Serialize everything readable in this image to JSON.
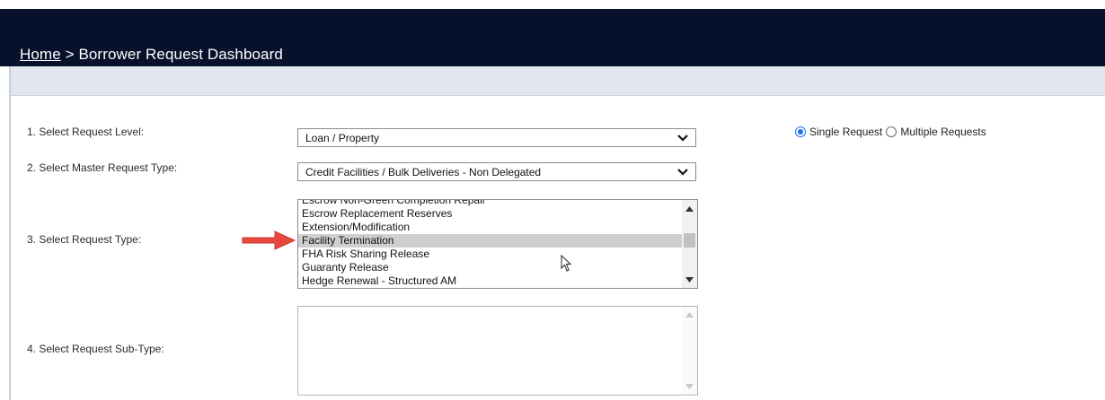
{
  "header": {
    "breadcrumb": {
      "home": "Home",
      "separator": " > ",
      "current": "Borrower Request Dashboard"
    }
  },
  "form": {
    "request_level": {
      "label": "1. Select Request Level:",
      "value": "Loan / Property"
    },
    "master_request_type": {
      "label": "2. Select Master Request Type:",
      "value": "Credit Facilities / Bulk Deliveries - Non Delegated"
    },
    "request_type": {
      "label": "3. Select Request Type:",
      "options": [
        "Escrow Non-Green Completion Repair",
        "Escrow Replacement Reserves",
        "Extension/Modification",
        "Facility Termination",
        "FHA Risk Sharing Release",
        "Guaranty Release",
        "Hedge Renewal - Structured AM"
      ],
      "selected": "Facility Termination"
    },
    "request_sub_type": {
      "label": "4. Select Request Sub-Type:",
      "value": ""
    },
    "mode": {
      "single_label": "Single Request",
      "multiple_label": "Multiple Requests",
      "selected": "Single Request"
    }
  },
  "colors": {
    "header_bg": "#08112b",
    "accent_arrow": "#e8473b",
    "radio_selected": "#1a73e8",
    "selected_row": "#cfcfcf"
  },
  "icons": [
    "chevron-down-icon",
    "scroll-up-icon",
    "scroll-down-icon",
    "red-arrow-icon",
    "mouse-pointer-icon"
  ]
}
